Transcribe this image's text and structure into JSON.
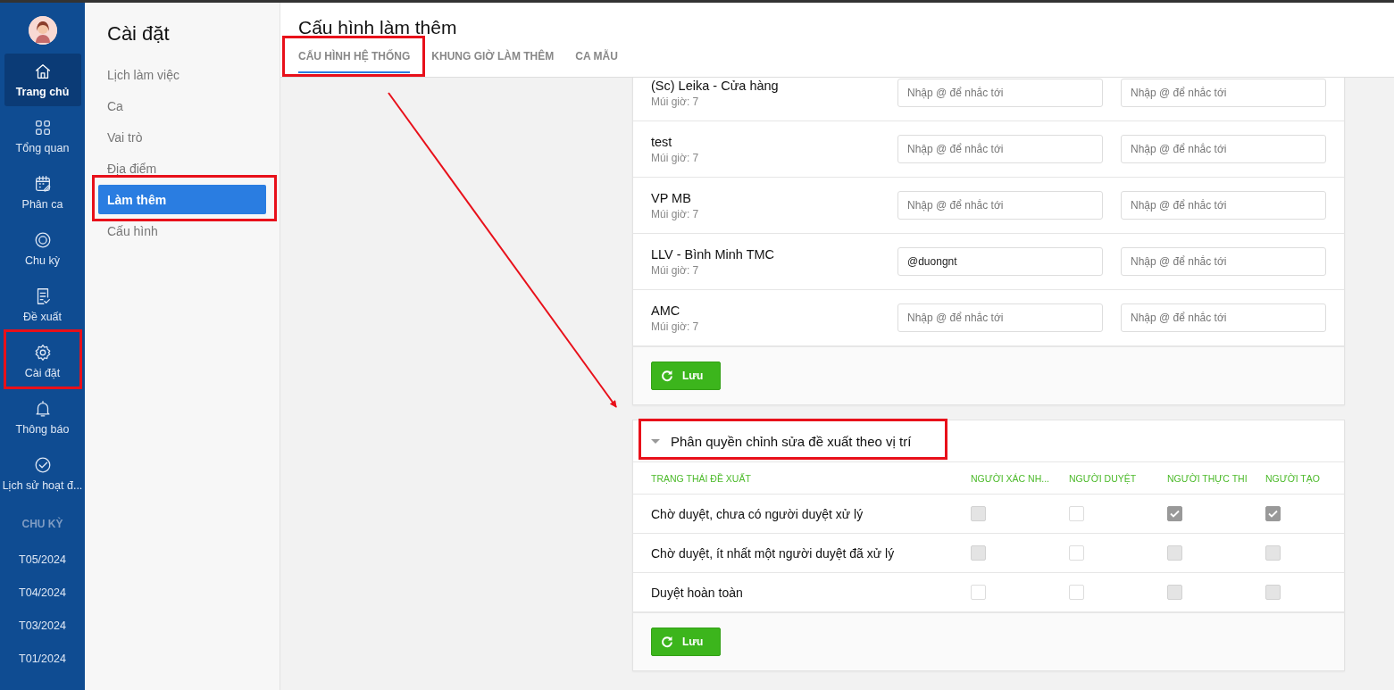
{
  "nav": {
    "items": [
      {
        "label": "Trang chủ",
        "selected": true,
        "highlighted": false
      },
      {
        "label": "Tổng quan",
        "selected": false,
        "highlighted": false
      },
      {
        "label": "Phân ca",
        "selected": false,
        "highlighted": false
      },
      {
        "label": "Chu kỳ",
        "selected": false,
        "highlighted": false
      },
      {
        "label": "Đề xuất",
        "selected": false,
        "highlighted": false
      },
      {
        "label": "Cài đặt",
        "selected": false,
        "highlighted": true
      },
      {
        "label": "Thông báo",
        "selected": false,
        "highlighted": false
      },
      {
        "label": "Lịch sử hoạt đ...",
        "selected": false,
        "highlighted": false
      }
    ],
    "cycle_heading": "CHU KỲ",
    "cycles": [
      "T05/2024",
      "T04/2024",
      "T03/2024",
      "T01/2024"
    ]
  },
  "settings": {
    "title": "Cài đặt",
    "items": [
      {
        "label": "Lịch làm việc",
        "selected": false,
        "highlighted": false
      },
      {
        "label": "Ca",
        "selected": false,
        "highlighted": false
      },
      {
        "label": "Vai trò",
        "selected": false,
        "highlighted": false
      },
      {
        "label": "Địa điểm",
        "selected": false,
        "highlighted": false
      },
      {
        "label": "Làm thêm",
        "selected": true,
        "highlighted": true
      },
      {
        "label": "Cấu hình",
        "selected": false,
        "highlighted": false
      }
    ]
  },
  "page": {
    "title": "Cấu hình làm thêm",
    "tabs": [
      {
        "label": "CẤU HÌNH HỆ THỐNG",
        "selected": true,
        "highlighted": true
      },
      {
        "label": "KHUNG GIỜ LÀM THÊM",
        "selected": false,
        "highlighted": false
      },
      {
        "label": "CA MẪU",
        "selected": false,
        "highlighted": false
      }
    ]
  },
  "locations": {
    "rows": [
      {
        "name": "(Sc) Leika - Cửa hàng",
        "timezone": "Múi giờ: 7",
        "fields": [
          {
            "placeholder": "Nhập @ để nhắc tới"
          },
          {
            "placeholder": "Nhập @ để nhắc tới"
          }
        ]
      },
      {
        "name": "test",
        "timezone": "Múi giờ: 7",
        "fields": [
          {
            "placeholder": "Nhập @ để nhắc tới"
          },
          {
            "placeholder": "Nhập @ để nhắc tới"
          }
        ]
      },
      {
        "name": "VP MB",
        "timezone": "Múi giờ: 7",
        "fields": [
          {
            "placeholder": "Nhập @ để nhắc tới"
          },
          {
            "placeholder": "Nhập @ để nhắc tới"
          }
        ]
      },
      {
        "name": "LLV - Bình Minh TMC",
        "timezone": "Múi giờ: 7",
        "fields": [
          {
            "value": "@duongnt"
          },
          {
            "placeholder": "Nhập @ để nhắc tới"
          }
        ]
      },
      {
        "name": "AMC",
        "timezone": "Múi giờ: 7",
        "fields": [
          {
            "placeholder": "Nhập @ để nhắc tới"
          },
          {
            "placeholder": "Nhập @ để nhắc tới"
          }
        ]
      }
    ],
    "save_button": "Lưu"
  },
  "permissions": {
    "title": "Phân quyền chỉnh sửa đề xuất theo vị trí",
    "expanded": true,
    "highlighted": true,
    "columns": [
      "TRẠNG THÁI ĐỀ XUẤT",
      "NGƯỜI XÁC NH...",
      "NGƯỜI DUYỆT",
      "NGƯỜI THỰC THI",
      "NGƯỜI TẠO"
    ],
    "rows": [
      {
        "status": "Chờ duyệt, chưa có người duyệt xử lý",
        "cells": [
          {
            "checked": false,
            "disabled": true
          },
          {
            "checked": false,
            "disabled": false
          },
          {
            "checked": true,
            "disabled": true
          },
          {
            "checked": true,
            "disabled": true
          }
        ]
      },
      {
        "status": "Chờ duyệt, ít nhất một người duyệt đã xử lý",
        "cells": [
          {
            "checked": false,
            "disabled": true
          },
          {
            "checked": false,
            "disabled": false
          },
          {
            "checked": false,
            "disabled": true
          },
          {
            "checked": false,
            "disabled": true
          }
        ]
      },
      {
        "status": "Duyệt hoàn toàn",
        "cells": [
          {
            "checked": false,
            "disabled": false
          },
          {
            "checked": false,
            "disabled": false
          },
          {
            "checked": false,
            "disabled": true
          },
          {
            "checked": false,
            "disabled": true
          }
        ]
      }
    ],
    "save_button": "Lưu"
  },
  "annotations": {
    "arrow": true
  }
}
